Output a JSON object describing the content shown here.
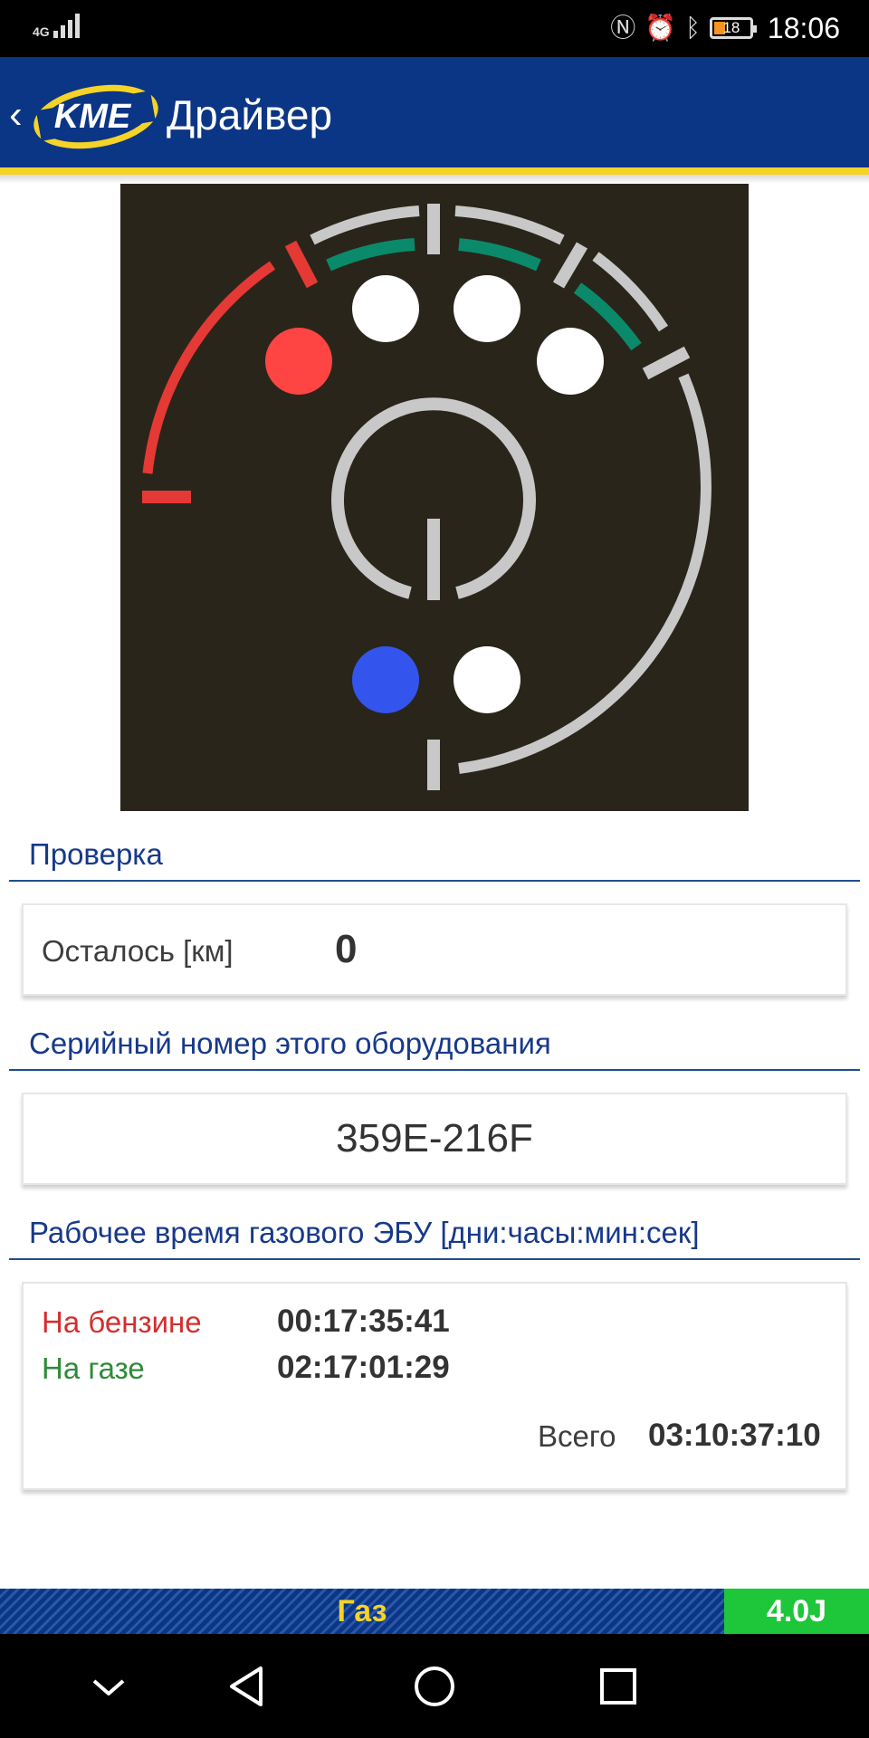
{
  "status_bar": {
    "network": "4G",
    "time": "18:06",
    "battery": "18",
    "icons": [
      "nfc-icon",
      "alarm-icon",
      "bluetooth-icon",
      "battery-icon"
    ]
  },
  "app_bar": {
    "logo": "KME",
    "title": "Драйвер"
  },
  "gauge": {
    "background": "#2a251a",
    "left_arc_color": "#e53935",
    "green_arc_color": "#0a8a6a",
    "ring_color": "#c8c8c8",
    "indicators": [
      {
        "name": "red",
        "color": "#ff4444"
      },
      {
        "name": "white",
        "color": "#ffffff"
      },
      {
        "name": "white",
        "color": "#ffffff"
      },
      {
        "name": "white",
        "color": "#ffffff"
      },
      {
        "name": "blue",
        "color": "#3355ee"
      },
      {
        "name": "white",
        "color": "#ffffff"
      }
    ]
  },
  "check": {
    "title": "Проверка",
    "label": "Осталось [км]",
    "value": "0"
  },
  "serial": {
    "title": "Серийный номер этого оборудования",
    "value": "359E-216F"
  },
  "runtime": {
    "title": "Рабочее время газового ЭБУ [дни:часы:мин:сек]",
    "petrol_label": "На бензине",
    "petrol_value": "00:17:35:41",
    "gas_label": "На газе",
    "gas_value": "02:17:01:29",
    "total_label": "Всего",
    "total_value": "03:10:37:10",
    "petrol_color": "#d32f2f",
    "gas_color": "#2e8b3a"
  },
  "bottom_status": {
    "fuel": "Газ",
    "version": "4.0J"
  },
  "nav": {
    "buttons": [
      "hide-keyboard",
      "back",
      "home",
      "recents"
    ]
  }
}
